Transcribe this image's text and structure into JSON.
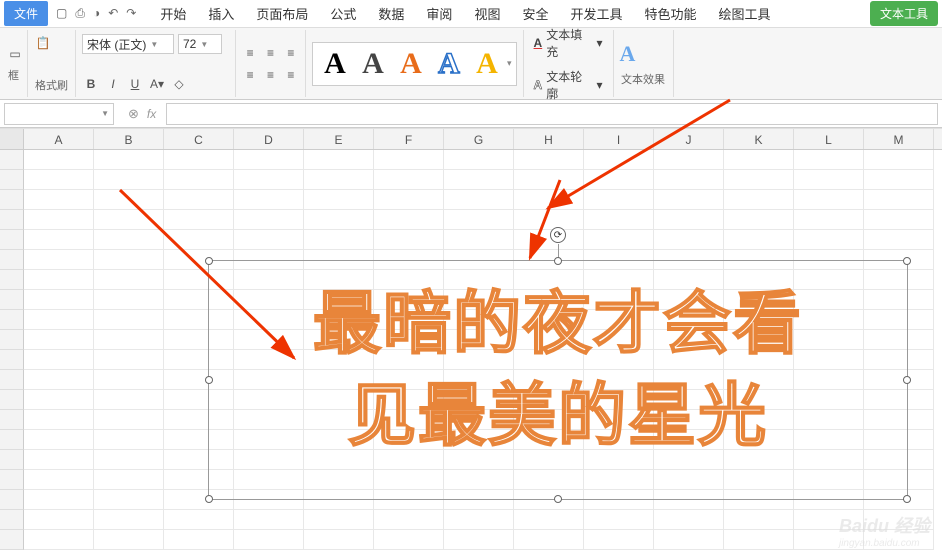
{
  "menubar": {
    "file": "文件",
    "tabs": [
      "开始",
      "插入",
      "页面布局",
      "公式",
      "数据",
      "审阅",
      "视图",
      "安全",
      "开发工具",
      "特色功能",
      "绘图工具"
    ],
    "tool_btn": "文本工具"
  },
  "ribbon": {
    "format_painter": "格式刷",
    "font_name": "宋体 (正文)",
    "font_size": "72",
    "bold": "B",
    "italic": "I",
    "underline": "U",
    "text_fill": "文本填充",
    "text_outline": "文本轮廓",
    "text_effects": "文本效果",
    "wordart_colors": [
      "#000000",
      "#333333",
      "#e86c1a",
      "#2a70c8",
      "#f4b400"
    ]
  },
  "formula_bar": {
    "name_box": "",
    "fx": "fx"
  },
  "columns": [
    "A",
    "B",
    "C",
    "D",
    "E",
    "F",
    "G",
    "H",
    "I",
    "J",
    "K",
    "L",
    "M"
  ],
  "textbox": {
    "line1": "最暗的夜才会看",
    "line2": "见最美的星光"
  },
  "watermark": {
    "brand": "Baidu 经验",
    "sub": "jingyan.baidu.com"
  }
}
